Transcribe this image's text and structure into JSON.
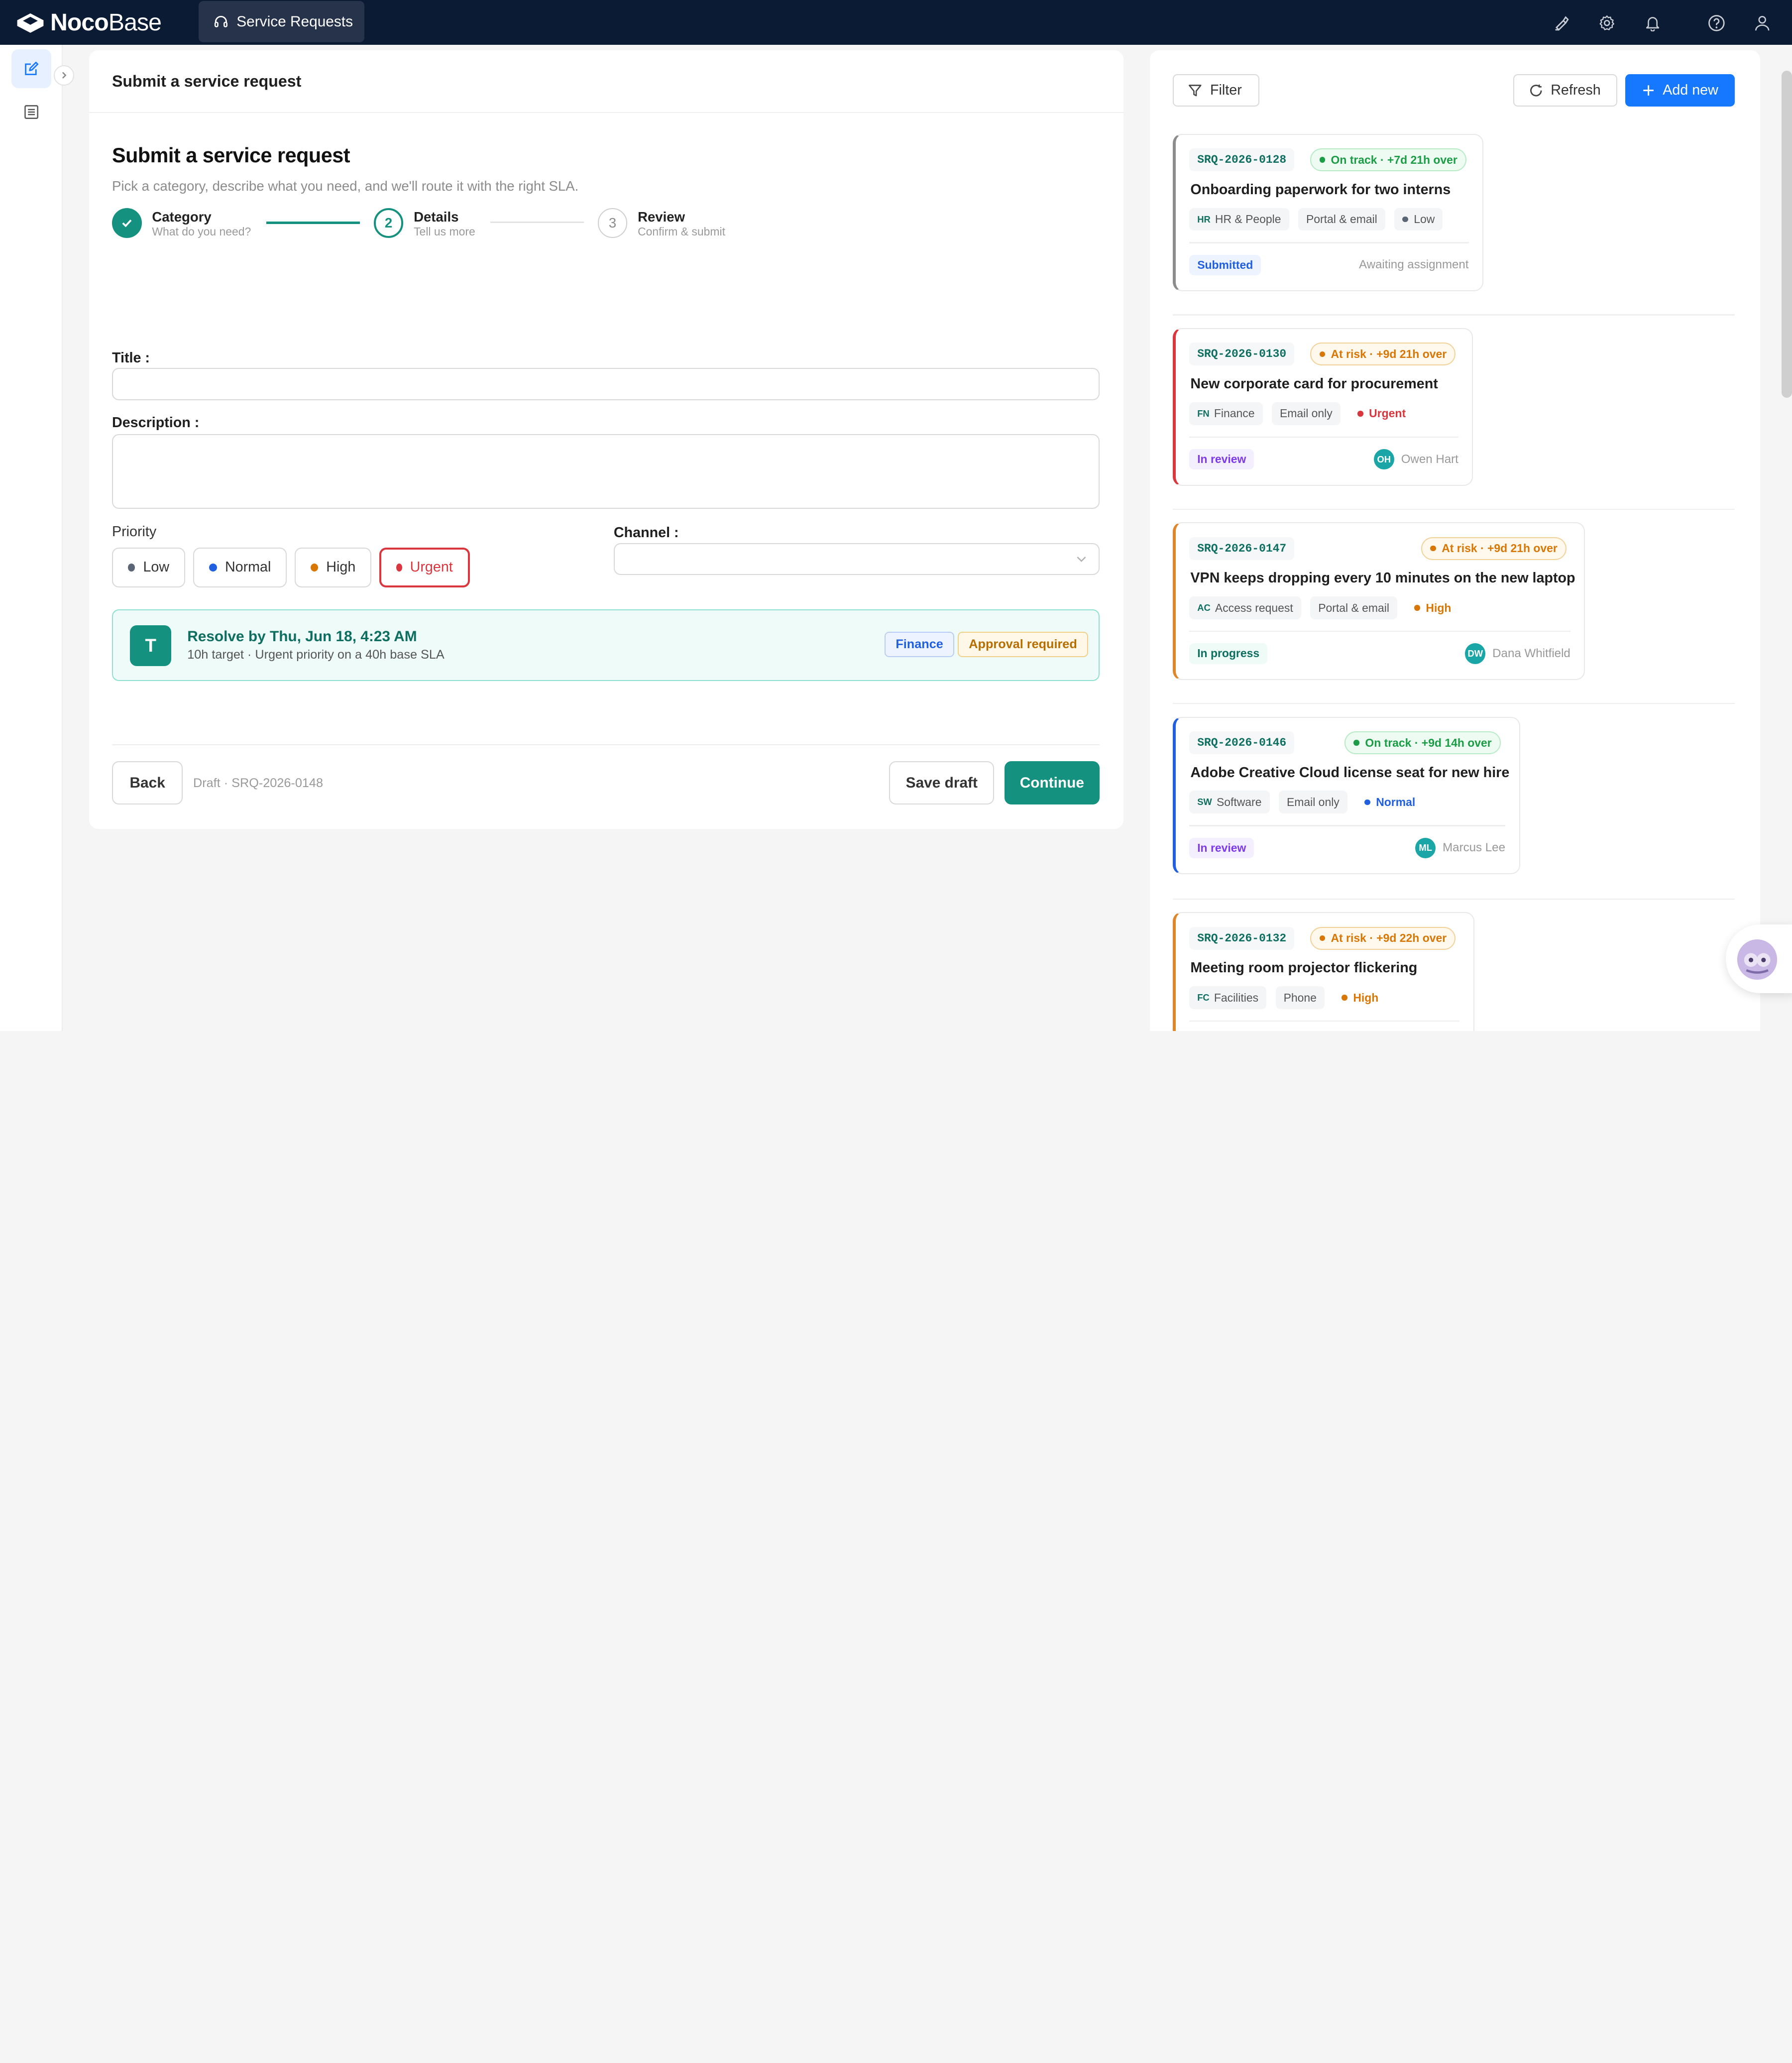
{
  "app": {
    "logo_bold": "Noco",
    "logo_light": "Base",
    "menu_tab": "Service Requests"
  },
  "form": {
    "card_title": "Submit a service request",
    "heading": "Submit a service request",
    "subtitle": "Pick a category, describe what you need, and we'll route it with the right SLA.",
    "steps": [
      {
        "num": "1",
        "title": "Category",
        "desc": "What do you need?",
        "state": "done"
      },
      {
        "num": "2",
        "title": "Details",
        "desc": "Tell us more",
        "state": "current"
      },
      {
        "num": "3",
        "title": "Review",
        "desc": "Confirm & submit",
        "state": "pending"
      }
    ],
    "title_label": "Title :",
    "title_value": "",
    "description_label": "Description :",
    "description_value": "",
    "priority_label": "Priority",
    "priorities": [
      {
        "label": "Low",
        "color": "#5b6675"
      },
      {
        "label": "Normal",
        "color": "#1f5fe0"
      },
      {
        "label": "High",
        "color": "#d97706"
      },
      {
        "label": "Urgent",
        "color": "#d9363e"
      }
    ],
    "selected_priority": "Urgent",
    "channel_label": "Channel :",
    "channel_value": "",
    "sla": {
      "avatar": "T",
      "title": "Resolve by Thu, Jun 18, 4:23 AM",
      "subtitle": "10h target · Urgent priority on a 40h base SLA",
      "tag_department": "Finance",
      "tag_approval": "Approval required"
    },
    "back_label": "Back",
    "draft_note": "Draft · SRQ-2026-0148",
    "save_draft_label": "Save draft",
    "continue_label": "Continue"
  },
  "list": {
    "filter_label": "Filter",
    "refresh_label": "Refresh",
    "add_new_label": "Add new",
    "requests": [
      {
        "id": "SRQ-2026-0128",
        "sla_text": "On track · +7d 21h over",
        "sla_state": "on-track",
        "title": "Onboarding paperwork for two interns",
        "dept_abbr": "HR",
        "dept": "HR & People",
        "channel": "Portal & email",
        "priority": "Low",
        "priority_color": "#5b6675",
        "status": "Submitted",
        "status_kind": "submitted",
        "assignee_initials": "",
        "assignee": "Awaiting assignment",
        "accent": "#8c8c8c"
      },
      {
        "id": "SRQ-2026-0130",
        "sla_text": "At risk · +9d 21h over",
        "sla_state": "at-risk",
        "title": "New corporate card for procurement",
        "dept_abbr": "FN",
        "dept": "Finance",
        "channel": "Email only",
        "priority": "Urgent",
        "priority_color": "#d9363e",
        "status": "In review",
        "status_kind": "review",
        "assignee_initials": "OH",
        "assignee": "Owen Hart",
        "accent": "#d9363e"
      },
      {
        "id": "SRQ-2026-0147",
        "sla_text": "At risk · +9d 21h over",
        "sla_state": "at-risk",
        "title": "VPN keeps dropping every 10 minutes on the new laptop",
        "dept_abbr": "AC",
        "dept": "Access request",
        "channel": "Portal & email",
        "priority": "High",
        "priority_color": "#d97706",
        "status": "In progress",
        "status_kind": "progress",
        "assignee_initials": "DW",
        "assignee": "Dana Whitfield",
        "accent": "#e0862a"
      },
      {
        "id": "SRQ-2026-0146",
        "sla_text": "On track · +9d 14h over",
        "sla_state": "on-track",
        "title": "Adobe Creative Cloud license seat for new hire",
        "dept_abbr": "SW",
        "dept": "Software",
        "channel": "Email only",
        "priority": "Normal",
        "priority_color": "#1f5fe0",
        "status": "In review",
        "status_kind": "review",
        "assignee_initials": "ML",
        "assignee": "Marcus Lee",
        "accent": "#1f5fe0"
      },
      {
        "id": "SRQ-2026-0132",
        "sla_text": "At risk · +9d 22h over",
        "sla_state": "at-risk",
        "title": "Meeting room projector flickering",
        "dept_abbr": "FC",
        "dept": "Facilities",
        "channel": "Phone",
        "priority": "High",
        "priority_color": "#d97706",
        "status": "",
        "status_kind": "none",
        "assignee_initials": "",
        "assignee": "",
        "accent": "#e0862a"
      }
    ]
  },
  "colors": {
    "brand_teal": "#14917f",
    "primary_blue": "#1677ff",
    "nav_dark": "#0b1b34"
  },
  "icons": [
    "logo-icon",
    "headset-icon",
    "brush-icon",
    "gear-icon",
    "bell-icon",
    "help-icon",
    "user-icon",
    "edit-icon",
    "list-icon",
    "chevron-right-icon",
    "check-icon",
    "chevron-down-icon",
    "filter-icon",
    "refresh-icon",
    "plus-icon"
  ]
}
